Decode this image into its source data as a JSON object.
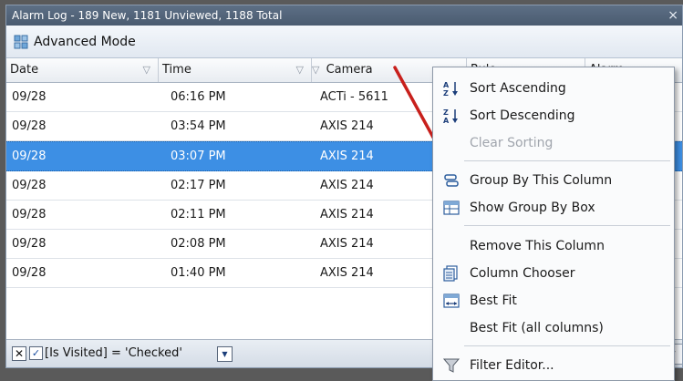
{
  "window": {
    "title": "Alarm Log - 189 New, 1181 Unviewed, 1188 Total",
    "close_glyph": "×"
  },
  "toolbar": {
    "mode_label": "Advanced Mode",
    "mode_icon": "grid-mode-icon"
  },
  "grid": {
    "columns": [
      "Date",
      "Time",
      "Camera",
      "Rule",
      "Alarm"
    ],
    "rows": [
      {
        "date": "09/28",
        "time": "06:16 PM",
        "camera": "ACTi - 5611"
      },
      {
        "date": "09/28",
        "time": "03:54 PM",
        "camera": "AXIS 214"
      },
      {
        "date": "09/28",
        "time": "03:07 PM",
        "camera": "AXIS 214"
      },
      {
        "date": "09/28",
        "time": "02:17 PM",
        "camera": "AXIS 214"
      },
      {
        "date": "09/28",
        "time": "02:11 PM",
        "camera": "AXIS 214"
      },
      {
        "date": "09/28",
        "time": "02:08 PM",
        "camera": "AXIS 214"
      },
      {
        "date": "09/28",
        "time": "01:40 PM",
        "camera": "AXIS 214"
      }
    ],
    "selected_row_index": 2
  },
  "filter": {
    "clear_glyph": "✕",
    "check_glyph": "✓",
    "expression": "[Is Visited] = 'Checked'",
    "dropdown_glyph": "▼",
    "editor_button_fragment": "er"
  },
  "context_menu": {
    "items": [
      {
        "label": "Sort Ascending",
        "icon": "sort-ascending-icon",
        "enabled": true
      },
      {
        "label": "Sort Descending",
        "icon": "sort-descending-icon",
        "enabled": true
      },
      {
        "label": "Clear Sorting",
        "icon": "",
        "enabled": false
      },
      {
        "label": "Group By This Column",
        "icon": "group-by-column-icon",
        "enabled": true
      },
      {
        "label": "Show Group By Box",
        "icon": "group-by-box-icon",
        "enabled": true
      },
      {
        "label": "Remove This Column",
        "icon": "",
        "enabled": true
      },
      {
        "label": "Column Chooser",
        "icon": "column-chooser-icon",
        "enabled": true
      },
      {
        "label": "Best Fit",
        "icon": "best-fit-icon",
        "enabled": true
      },
      {
        "label": "Best Fit (all columns)",
        "icon": "",
        "enabled": true
      },
      {
        "label": "Filter Editor...",
        "icon": "filter-funnel-icon",
        "enabled": true
      }
    ]
  },
  "colors": {
    "selection": "#3d8fe4",
    "annotation_arrow": "#c8201c",
    "title_bar": "#4f6075"
  }
}
